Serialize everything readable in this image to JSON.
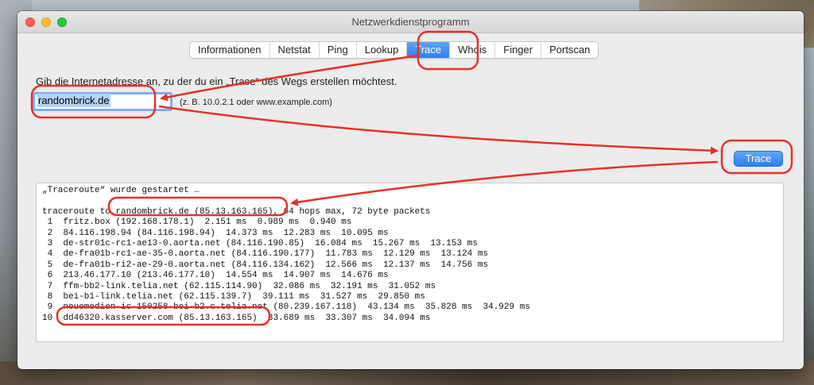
{
  "window": {
    "title": "Netzwerkdienstprogramm"
  },
  "tabs": [
    {
      "label": "Informationen",
      "selected": false
    },
    {
      "label": "Netstat",
      "selected": false
    },
    {
      "label": "Ping",
      "selected": false
    },
    {
      "label": "Lookup",
      "selected": false
    },
    {
      "label": "Trace",
      "selected": true
    },
    {
      "label": "Whois",
      "selected": false
    },
    {
      "label": "Finger",
      "selected": false
    },
    {
      "label": "Portscan",
      "selected": false
    }
  ],
  "trace": {
    "prompt": "Gib die Internetadresse an, zu der du ein „Trace“ des Wegs erstellen möchtest.",
    "address_value": "randombrick.de",
    "address_hint": "(z. B. 10.0.2.1 oder www.example.com)",
    "button_label": "Trace"
  },
  "output": {
    "started": "„Traceroute“ wurde gestartet …",
    "header": "traceroute to randombrick.de (85.13.163.165), 64 hops max, 72 byte packets",
    "hops": [
      " 1  fritz.box (192.168.178.1)  2.151 ms  0.989 ms  0.940 ms",
      " 2  84.116.198.94 (84.116.198.94)  14.373 ms  12.283 ms  10.095 ms",
      " 3  de-str01c-rc1-ae13-0.aorta.net (84.116.190.85)  16.084 ms  15.267 ms  13.153 ms",
      " 4  de-fra01b-rc1-ae-35-0.aorta.net (84.116.190.177)  11.783 ms  12.129 ms  13.124 ms",
      " 5  de-fra01b-ri2-ae-29-0.aorta.net (84.116.134.162)  12.566 ms  12.137 ms  14.756 ms",
      " 6  213.46.177.10 (213.46.177.10)  14.554 ms  14.907 ms  14.676 ms",
      " 7  ffm-bb2-link.telia.net (62.115.114.90)  32.086 ms  32.191 ms  31.052 ms",
      " 8  bei-b1-link.telia.net (62.115.139.7)  39.111 ms  31.527 ms  29.850 ms",
      " 9  neuemedien-ic-150258-bei-b2.c.telia.net (80.239.167.118)  43.134 ms  35.828 ms  34.929 ms",
      "10  dd46320.kasserver.com (85.13.163.165)  33.689 ms  33.307 ms  34.094 ms"
    ]
  },
  "colors": {
    "annotation": "#e8302a",
    "accent": "#2f7ff0"
  }
}
